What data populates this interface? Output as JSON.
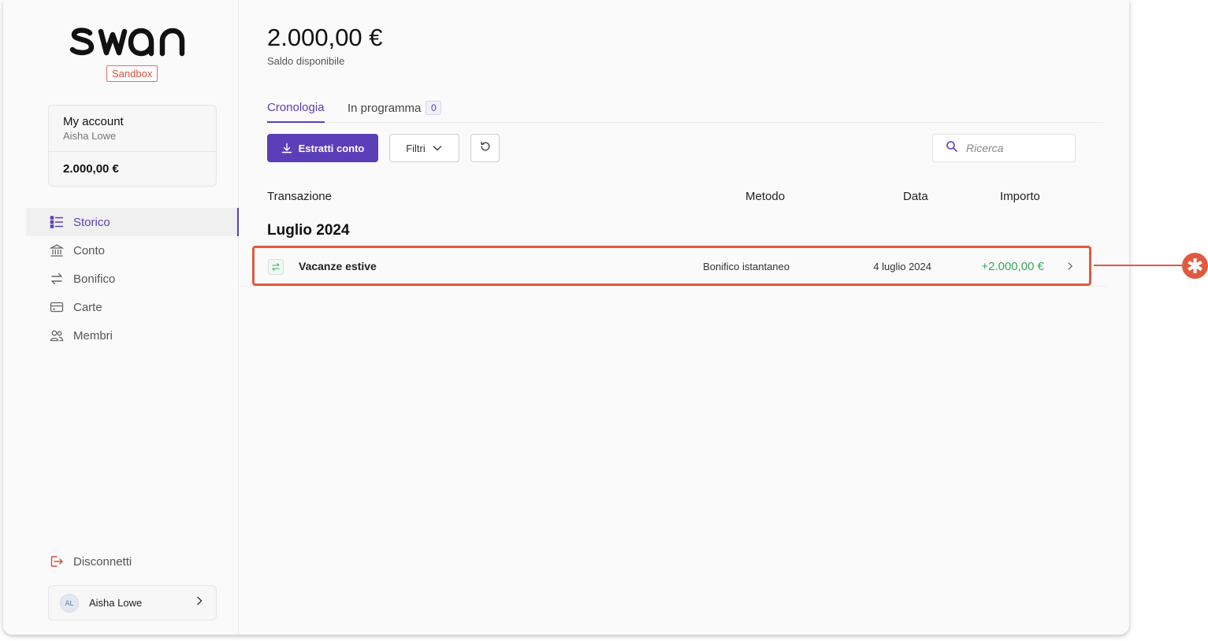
{
  "brand": {
    "logo": "swan",
    "env_badge": "Sandbox"
  },
  "account": {
    "name": "My account",
    "holder": "Aisha Lowe",
    "balance": "2.000,00 €"
  },
  "nav": {
    "items": [
      {
        "label": "Storico",
        "icon": "list-icon",
        "active": true
      },
      {
        "label": "Conto",
        "icon": "bank-icon",
        "active": false
      },
      {
        "label": "Bonifico",
        "icon": "transfer-icon",
        "active": false
      },
      {
        "label": "Carte",
        "icon": "card-icon",
        "active": false
      },
      {
        "label": "Membri",
        "icon": "members-icon",
        "active": false
      }
    ],
    "logout": "Disconnetti"
  },
  "user": {
    "initials": "AL",
    "name": "Aisha Lowe"
  },
  "header": {
    "balance": "2.000,00 €",
    "balance_label": "Saldo disponibile"
  },
  "tabs": [
    {
      "label": "Cronologia",
      "active": true
    },
    {
      "label": "In programma",
      "count": "0",
      "active": false
    }
  ],
  "toolbar": {
    "export_label": "Estratti conto",
    "filter_label": "Filtri",
    "search_placeholder": "Ricerca"
  },
  "table": {
    "columns": {
      "transaction": "Transazione",
      "method": "Metodo",
      "date": "Data",
      "amount": "Importo"
    },
    "groups": [
      {
        "month": "Luglio 2024",
        "rows": [
          {
            "name": "Vacanze estive",
            "method": "Bonifico istantaneo",
            "date": "4 luglio 2024",
            "amount": "+2.000,00 €"
          }
        ]
      }
    ]
  },
  "annotation": {
    "marker": "✱",
    "color": "#df5a40"
  },
  "colors": {
    "accent": "#5b3fb8",
    "positive": "#3aa65c",
    "danger": "#d6503b"
  }
}
